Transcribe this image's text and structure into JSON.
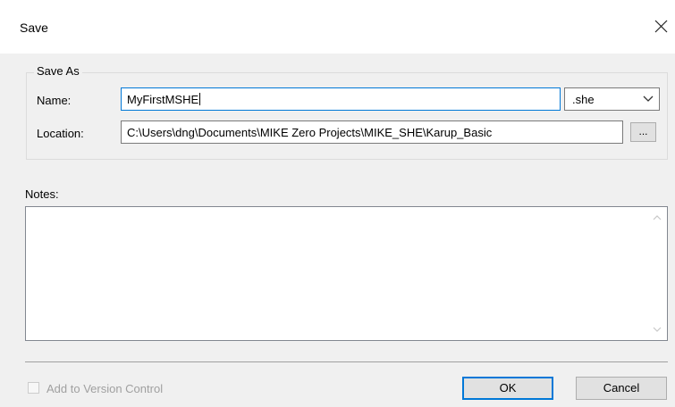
{
  "window": {
    "title": "Save"
  },
  "save_as": {
    "group_label": "Save As",
    "name_label": "Name:",
    "name_value": "MyFirstMSHE",
    "extension": ".she",
    "location_label": "Location:",
    "location_value": "C:\\Users\\dng\\Documents\\MIKE Zero Projects\\MIKE_SHE\\Karup_Basic",
    "browse_label": "..."
  },
  "notes": {
    "label": "Notes:",
    "value": ""
  },
  "footer": {
    "version_control_label": "Add to Version Control",
    "version_control_checked": false,
    "version_control_enabled": false,
    "ok_label": "OK",
    "cancel_label": "Cancel"
  },
  "colors": {
    "focus_accent": "#0078d7",
    "dialog_bg": "#f0f0f0",
    "disabled_text": "#a0a0a0"
  }
}
